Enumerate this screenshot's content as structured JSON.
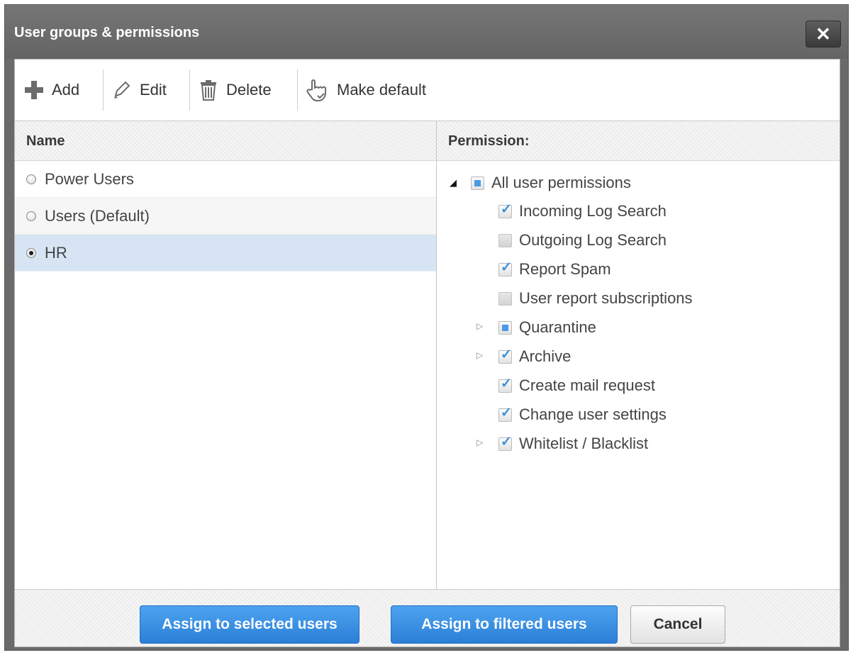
{
  "dialog": {
    "title": "User groups & permissions",
    "close_label": "✕"
  },
  "toolbar": {
    "add": "Add",
    "edit": "Edit",
    "delete": "Delete",
    "make_default": "Make default"
  },
  "groups": {
    "header": "Name",
    "items": [
      {
        "label": "Power Users",
        "selected": false
      },
      {
        "label": "Users (Default)",
        "selected": false
      },
      {
        "label": "HR",
        "selected": true
      }
    ]
  },
  "permissions": {
    "header": "Permission:",
    "root": {
      "label": "All user permissions",
      "state": "partial",
      "expanded": true
    },
    "items": [
      {
        "label": "Incoming Log Search",
        "state": "checked",
        "expandable": false
      },
      {
        "label": "Outgoing Log Search",
        "state": "unchecked",
        "expandable": false
      },
      {
        "label": "Report Spam",
        "state": "checked",
        "expandable": false
      },
      {
        "label": "User report subscriptions",
        "state": "unchecked",
        "expandable": false
      },
      {
        "label": "Quarantine",
        "state": "partial",
        "expandable": true
      },
      {
        "label": "Archive",
        "state": "checked",
        "expandable": true
      },
      {
        "label": "Create mail request",
        "state": "checked",
        "expandable": false
      },
      {
        "label": "Change user settings",
        "state": "checked",
        "expandable": false
      },
      {
        "label": "Whitelist / Blacklist",
        "state": "checked",
        "expandable": true
      }
    ]
  },
  "footer": {
    "assign_selected": "Assign to selected users",
    "assign_filtered": "Assign to filtered users",
    "cancel": "Cancel"
  },
  "colors": {
    "accent": "#2b7fd6",
    "selected_row": "#d7e4f3",
    "titlebar": "#6a6a6a"
  }
}
